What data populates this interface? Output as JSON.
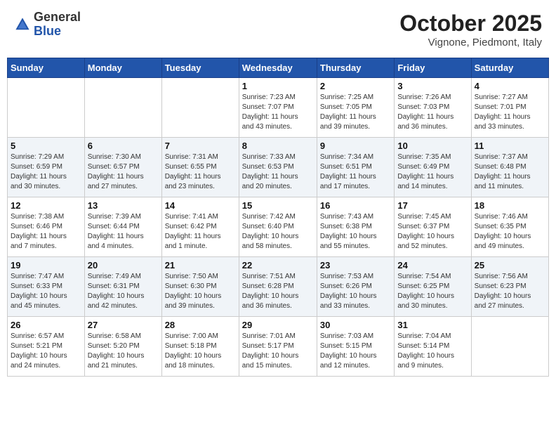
{
  "logo": {
    "general": "General",
    "blue": "Blue"
  },
  "header": {
    "month": "October 2025",
    "location": "Vignone, Piedmont, Italy"
  },
  "weekdays": [
    "Sunday",
    "Monday",
    "Tuesday",
    "Wednesday",
    "Thursday",
    "Friday",
    "Saturday"
  ],
  "weeks": [
    [
      {
        "day": "",
        "info": ""
      },
      {
        "day": "",
        "info": ""
      },
      {
        "day": "",
        "info": ""
      },
      {
        "day": "1",
        "info": "Sunrise: 7:23 AM\nSunset: 7:07 PM\nDaylight: 11 hours\nand 43 minutes."
      },
      {
        "day": "2",
        "info": "Sunrise: 7:25 AM\nSunset: 7:05 PM\nDaylight: 11 hours\nand 39 minutes."
      },
      {
        "day": "3",
        "info": "Sunrise: 7:26 AM\nSunset: 7:03 PM\nDaylight: 11 hours\nand 36 minutes."
      },
      {
        "day": "4",
        "info": "Sunrise: 7:27 AM\nSunset: 7:01 PM\nDaylight: 11 hours\nand 33 minutes."
      }
    ],
    [
      {
        "day": "5",
        "info": "Sunrise: 7:29 AM\nSunset: 6:59 PM\nDaylight: 11 hours\nand 30 minutes."
      },
      {
        "day": "6",
        "info": "Sunrise: 7:30 AM\nSunset: 6:57 PM\nDaylight: 11 hours\nand 27 minutes."
      },
      {
        "day": "7",
        "info": "Sunrise: 7:31 AM\nSunset: 6:55 PM\nDaylight: 11 hours\nand 23 minutes."
      },
      {
        "day": "8",
        "info": "Sunrise: 7:33 AM\nSunset: 6:53 PM\nDaylight: 11 hours\nand 20 minutes."
      },
      {
        "day": "9",
        "info": "Sunrise: 7:34 AM\nSunset: 6:51 PM\nDaylight: 11 hours\nand 17 minutes."
      },
      {
        "day": "10",
        "info": "Sunrise: 7:35 AM\nSunset: 6:49 PM\nDaylight: 11 hours\nand 14 minutes."
      },
      {
        "day": "11",
        "info": "Sunrise: 7:37 AM\nSunset: 6:48 PM\nDaylight: 11 hours\nand 11 minutes."
      }
    ],
    [
      {
        "day": "12",
        "info": "Sunrise: 7:38 AM\nSunset: 6:46 PM\nDaylight: 11 hours\nand 7 minutes."
      },
      {
        "day": "13",
        "info": "Sunrise: 7:39 AM\nSunset: 6:44 PM\nDaylight: 11 hours\nand 4 minutes."
      },
      {
        "day": "14",
        "info": "Sunrise: 7:41 AM\nSunset: 6:42 PM\nDaylight: 11 hours\nand 1 minute."
      },
      {
        "day": "15",
        "info": "Sunrise: 7:42 AM\nSunset: 6:40 PM\nDaylight: 10 hours\nand 58 minutes."
      },
      {
        "day": "16",
        "info": "Sunrise: 7:43 AM\nSunset: 6:38 PM\nDaylight: 10 hours\nand 55 minutes."
      },
      {
        "day": "17",
        "info": "Sunrise: 7:45 AM\nSunset: 6:37 PM\nDaylight: 10 hours\nand 52 minutes."
      },
      {
        "day": "18",
        "info": "Sunrise: 7:46 AM\nSunset: 6:35 PM\nDaylight: 10 hours\nand 49 minutes."
      }
    ],
    [
      {
        "day": "19",
        "info": "Sunrise: 7:47 AM\nSunset: 6:33 PM\nDaylight: 10 hours\nand 45 minutes."
      },
      {
        "day": "20",
        "info": "Sunrise: 7:49 AM\nSunset: 6:31 PM\nDaylight: 10 hours\nand 42 minutes."
      },
      {
        "day": "21",
        "info": "Sunrise: 7:50 AM\nSunset: 6:30 PM\nDaylight: 10 hours\nand 39 minutes."
      },
      {
        "day": "22",
        "info": "Sunrise: 7:51 AM\nSunset: 6:28 PM\nDaylight: 10 hours\nand 36 minutes."
      },
      {
        "day": "23",
        "info": "Sunrise: 7:53 AM\nSunset: 6:26 PM\nDaylight: 10 hours\nand 33 minutes."
      },
      {
        "day": "24",
        "info": "Sunrise: 7:54 AM\nSunset: 6:25 PM\nDaylight: 10 hours\nand 30 minutes."
      },
      {
        "day": "25",
        "info": "Sunrise: 7:56 AM\nSunset: 6:23 PM\nDaylight: 10 hours\nand 27 minutes."
      }
    ],
    [
      {
        "day": "26",
        "info": "Sunrise: 6:57 AM\nSunset: 5:21 PM\nDaylight: 10 hours\nand 24 minutes."
      },
      {
        "day": "27",
        "info": "Sunrise: 6:58 AM\nSunset: 5:20 PM\nDaylight: 10 hours\nand 21 minutes."
      },
      {
        "day": "28",
        "info": "Sunrise: 7:00 AM\nSunset: 5:18 PM\nDaylight: 10 hours\nand 18 minutes."
      },
      {
        "day": "29",
        "info": "Sunrise: 7:01 AM\nSunset: 5:17 PM\nDaylight: 10 hours\nand 15 minutes."
      },
      {
        "day": "30",
        "info": "Sunrise: 7:03 AM\nSunset: 5:15 PM\nDaylight: 10 hours\nand 12 minutes."
      },
      {
        "day": "31",
        "info": "Sunrise: 7:04 AM\nSunset: 5:14 PM\nDaylight: 10 hours\nand 9 minutes."
      },
      {
        "day": "",
        "info": ""
      }
    ]
  ]
}
